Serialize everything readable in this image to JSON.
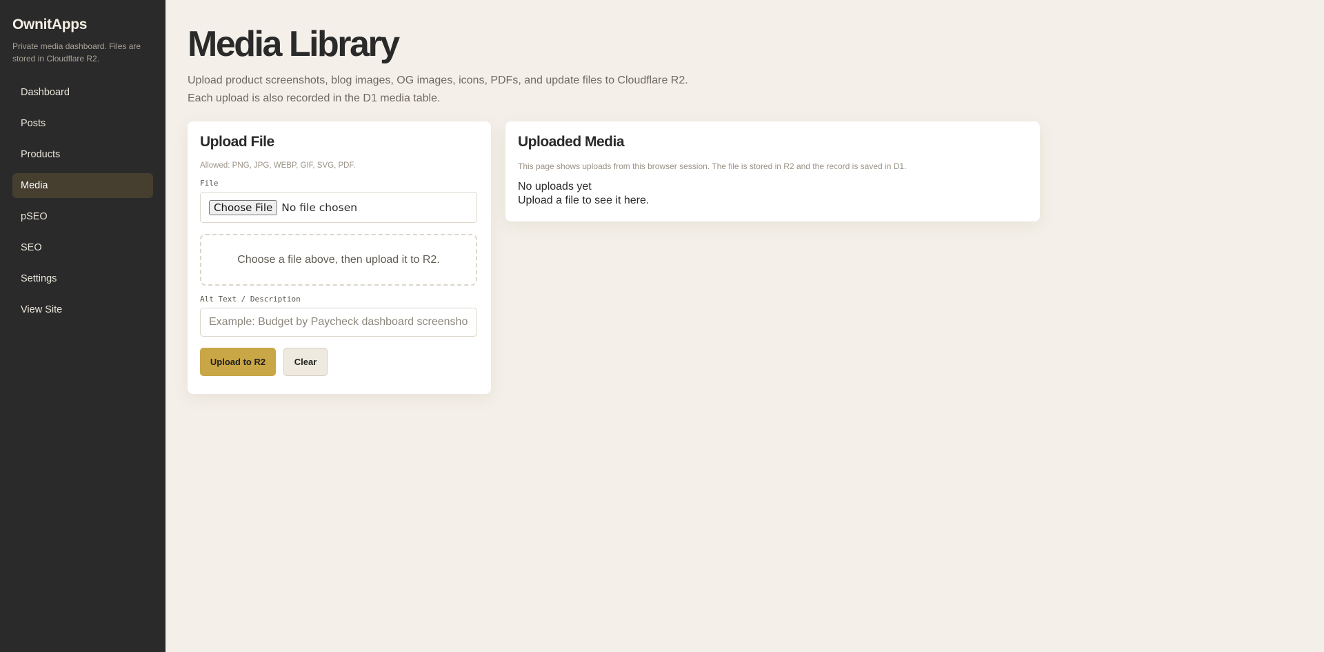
{
  "sidebar": {
    "brand": "OwnitApps",
    "subtitle": "Private media dashboard. Files are stored in Cloudflare R2.",
    "items": [
      {
        "label": "Dashboard"
      },
      {
        "label": "Posts"
      },
      {
        "label": "Products"
      },
      {
        "label": "Media",
        "active": true
      },
      {
        "label": "pSEO"
      },
      {
        "label": "SEO"
      },
      {
        "label": "Settings"
      },
      {
        "label": "View Site"
      }
    ]
  },
  "header": {
    "title": "Media Library",
    "description_line1": "Upload product screenshots, blog images, OG images, icons, PDFs, and update files to Cloudflare R2.",
    "description_line2": "Each upload is also recorded in the D1 media table."
  },
  "upload": {
    "title": "Upload File",
    "allowed": "Allowed: PNG, JPG, WEBP, GIF, SVG, PDF.",
    "file_label": "File",
    "choose_button": "Choose File",
    "file_status": "No file chosen",
    "drop_hint": "Choose a file above, then upload it to R2.",
    "alt_label": "Alt Text / Description",
    "alt_value": "",
    "alt_placeholder": "Example: Budget by Paycheck dashboard screenshot",
    "upload_button": "Upload to R2",
    "clear_button": "Clear"
  },
  "media": {
    "title": "Uploaded Media",
    "hint": "This page shows uploads from this browser session. The file is stored in R2 and the record is saved in D1.",
    "empty_title": "No uploads yet",
    "empty_sub": "Upload a file to see it here."
  },
  "colors": {
    "sidebar_bg": "#2a2a2a",
    "page_bg": "#f4f0e9",
    "accent": "#c9a646",
    "active_nav": "#463f30"
  }
}
